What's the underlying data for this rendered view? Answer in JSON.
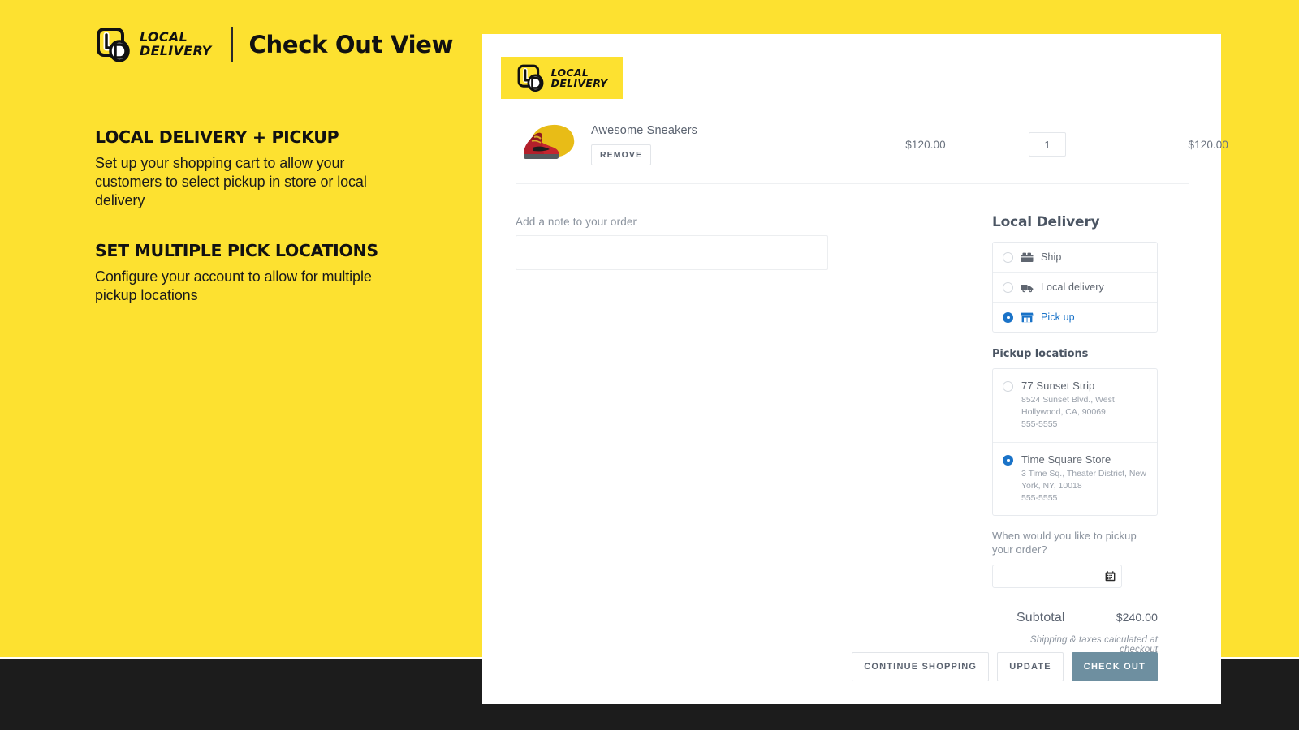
{
  "theme": {
    "yellow": "#fde130",
    "dark": "#1c1c1c",
    "accent_blue": "#1a73c8",
    "checkout_button": "#6e8fa0"
  },
  "header": {
    "brand_line1": "LOCAL",
    "brand_line2": "DELIVERY",
    "title": "Check Out View"
  },
  "promo": {
    "blocks": [
      {
        "heading": "LOCAL DELIVERY + PICKUP",
        "body": "Set up your shopping cart to allow your customers to select pickup in store or local delivery"
      },
      {
        "heading": "SET MULTIPLE PICK LOCATIONS",
        "body": "Configure your account to allow for multiple pickup locations"
      }
    ]
  },
  "cart": {
    "logo_line1": "LOCAL",
    "logo_line2": "DELIVERY",
    "item": {
      "name": "Awesome Sneakers",
      "remove_label": "REMOVE",
      "price": "$120.00",
      "quantity": "1",
      "line_total": "$120.00"
    },
    "note": {
      "label": "Add a note to your order",
      "value": "",
      "placeholder": ""
    }
  },
  "local_delivery": {
    "title": "Local Delivery",
    "options": [
      {
        "label": "Ship",
        "icon": "ship-box-icon",
        "selected": false
      },
      {
        "label": "Local delivery",
        "icon": "delivery-truck-icon",
        "selected": false
      },
      {
        "label": "Pick up",
        "icon": "store-icon",
        "selected": true
      }
    ],
    "pickup_locations_title": "Pickup locations",
    "pickup_locations": [
      {
        "name": "77 Sunset Strip",
        "address_line1": "8524 Sunset Blvd., West",
        "address_line2": "Hollywood, CA, 90069",
        "phone": "555-5555",
        "selected": false
      },
      {
        "name": "Time Square Store",
        "address_line1": "3 Time Sq., Theater District, New",
        "address_line2": "York, NY, 10018",
        "phone": "555-5555",
        "selected": true
      }
    ],
    "when_label": "When would you like to pickup your order?",
    "date_value": "",
    "date_icon": "calendar-icon"
  },
  "summary": {
    "subtotal_label": "Subtotal",
    "subtotal_value": "$240.00",
    "taxes_note": "Shipping & taxes calculated at checkout"
  },
  "actions": {
    "continue_shopping": "CONTINUE SHOPPING",
    "update": "UPDATE",
    "check_out": "CHECK OUT"
  }
}
